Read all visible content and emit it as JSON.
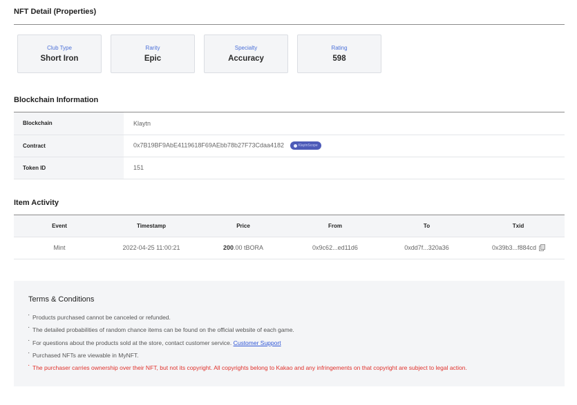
{
  "headings": {
    "nft_detail": "NFT Detail (Properties)",
    "blockchain": "Blockchain Information",
    "activity": "Item Activity"
  },
  "properties": [
    {
      "label": "Club Type",
      "value": "Short Iron"
    },
    {
      "label": "Rarity",
      "value": "Epic"
    },
    {
      "label": "Specialty",
      "value": "Accuracy"
    },
    {
      "label": "Rating",
      "value": "598"
    }
  ],
  "blockchain_info": {
    "rows": [
      {
        "key": "Blockchain",
        "value": "Klaytn"
      },
      {
        "key": "Contract",
        "value": "0x7B19BF9AbE4119618F69AEbb78b27F73Cdaa4182"
      },
      {
        "key": "Token ID",
        "value": "151"
      }
    ],
    "scope_badge": "KlaytnScope"
  },
  "activity": {
    "columns": [
      "Event",
      "Timestamp",
      "Price",
      "From",
      "To",
      "Txid"
    ],
    "rows": [
      {
        "event": "Mint",
        "timestamp": "2022-04-25 11:00:21",
        "price_value": "200",
        "price_decimals": ".00",
        "price_unit": " tBORA",
        "from": "0x9c62...ed11d6",
        "to": "0xdd7f...320a36",
        "txid": "0x39b3...f884cd"
      }
    ]
  },
  "terms": {
    "title": "Terms & Conditions",
    "items": [
      "Products purchased cannot be canceled or refunded.",
      "The detailed probabilities of random chance items can be found on the official website of each game.",
      "For questions about the products sold at the store, contact customer service.",
      "Purchased NFTs are viewable in MyNFT.",
      "The purchaser carries ownership over their NFT, but not its copyright. All copyrights belong to Kakao and any infringements on that copyright are subject to legal action."
    ],
    "support_link": "Customer Support"
  },
  "colors": {
    "accent": "#4a6fd8",
    "warning": "#e0302a",
    "link": "#2f56d6",
    "panel": "#f4f5f7"
  }
}
